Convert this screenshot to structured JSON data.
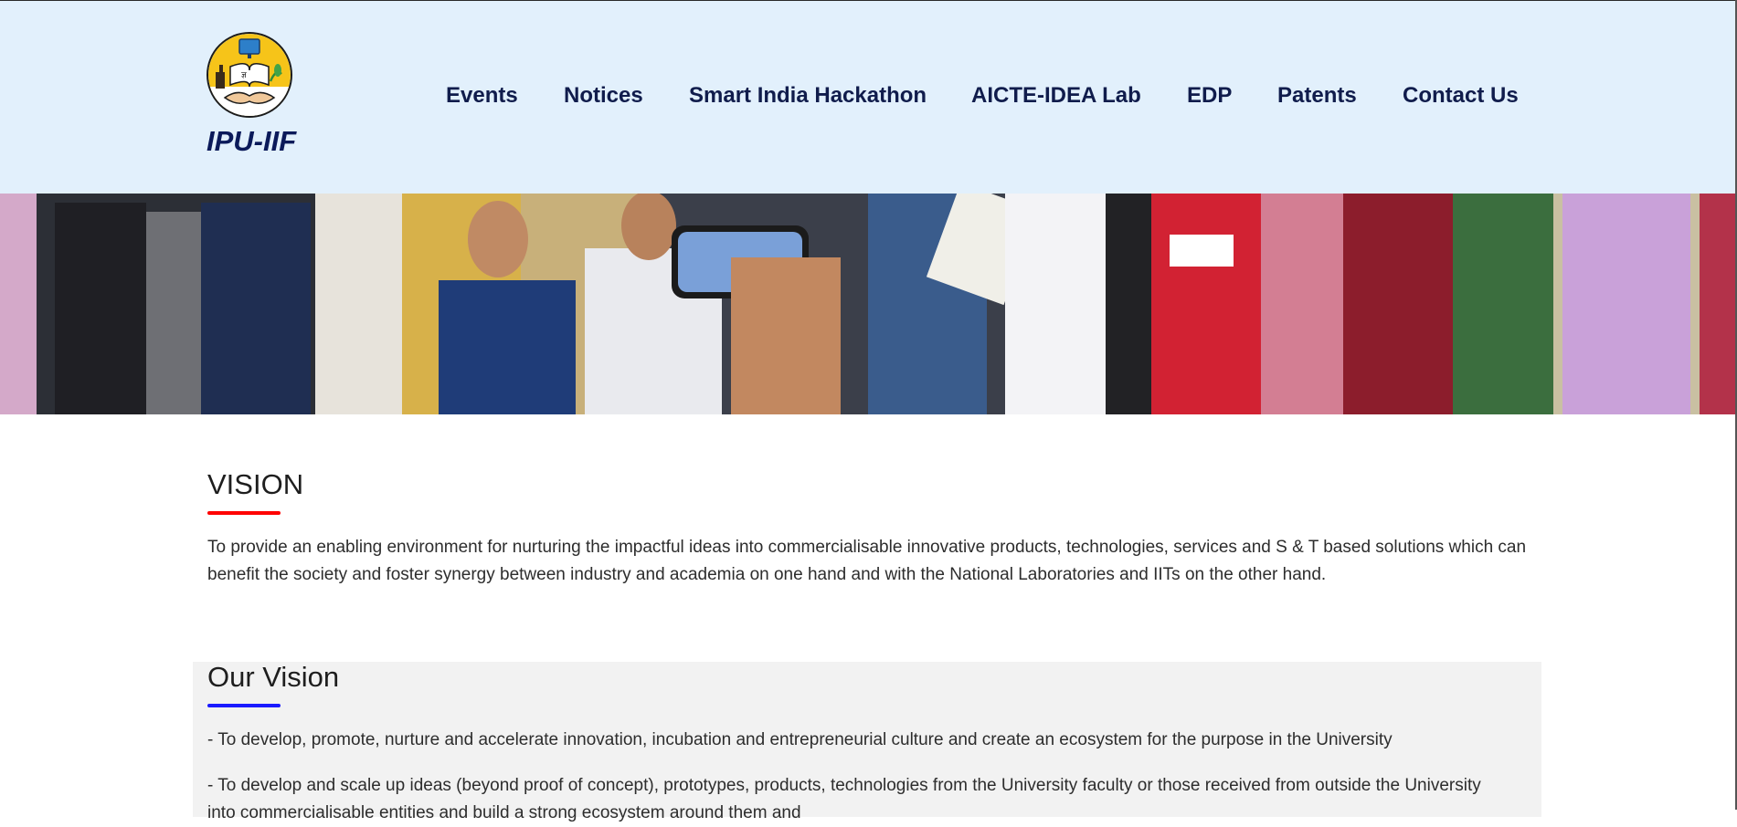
{
  "brand": {
    "name": "IPU-IIF",
    "logo_text": "ज्ञ"
  },
  "nav": {
    "items": [
      {
        "label": "Events"
      },
      {
        "label": "Notices"
      },
      {
        "label": "Smart India Hackathon"
      },
      {
        "label": "AICTE-IDEA Lab"
      },
      {
        "label": "EDP"
      },
      {
        "label": "Patents"
      },
      {
        "label": "Contact Us"
      }
    ]
  },
  "banner": {
    "icon": "group-photo-image"
  },
  "vision": {
    "title": "VISION",
    "underline_color": "#ff0000",
    "text": "To provide an enabling environment for nurturing the impactful ideas into commercialisable innovative products, technologies, services and S & T based solutions which can benefit the society and foster synergy between industry and academia on one hand and with the National Laboratories and IITs on the other hand."
  },
  "our_vision": {
    "title": "Our Vision",
    "underline_color": "#1a1aff",
    "points": [
      "- To develop, promote, nurture and accelerate innovation, incubation and entrepreneurial culture and create an ecosystem for the purpose in the University",
      "- To develop and scale up ideas (beyond proof of concept), prototypes, products, technologies from the University faculty or those received from outside the University into commercialisable entities and build a strong ecosystem around them and"
    ]
  },
  "colors": {
    "header_bg": "#e2f0fc",
    "nav_text": "#101c4c",
    "brand_text": "#0b1a5a",
    "box_bg": "#f2f2f2"
  }
}
